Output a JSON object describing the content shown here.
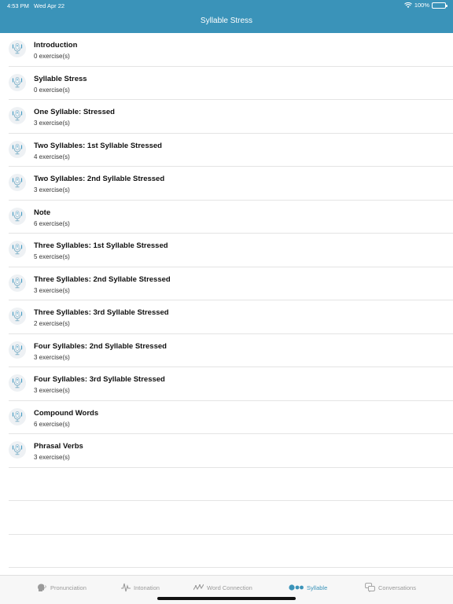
{
  "status": {
    "time": "4:53 PM",
    "date": "Wed Apr 22",
    "battery": "100%"
  },
  "header": {
    "title": "Syllable Stress"
  },
  "lessons": [
    {
      "title": "Introduction",
      "subtitle": "0 exercise(s)"
    },
    {
      "title": "Syllable Stress",
      "subtitle": "0 exercise(s)"
    },
    {
      "title": "One Syllable: Stressed",
      "subtitle": "3 exercise(s)"
    },
    {
      "title": "Two Syllables: 1st Syllable Stressed",
      "subtitle": "4 exercise(s)"
    },
    {
      "title": "Two Syllables: 2nd Syllable Stressed",
      "subtitle": "3 exercise(s)"
    },
    {
      "title": "Note",
      "subtitle": "6 exercise(s)"
    },
    {
      "title": "Three Syllables: 1st Syllable Stressed",
      "subtitle": "5 exercise(s)"
    },
    {
      "title": "Three Syllables: 2nd Syllable Stressed",
      "subtitle": "3 exercise(s)"
    },
    {
      "title": "Three Syllables: 3rd Syllable Stressed",
      "subtitle": "2 exercise(s)"
    },
    {
      "title": "Four Syllables: 2nd Syllable Stressed",
      "subtitle": "3 exercise(s)"
    },
    {
      "title": "Four Syllables: 3rd Syllable Stressed",
      "subtitle": "3 exercise(s)"
    },
    {
      "title": "Compound Words",
      "subtitle": "6 exercise(s)"
    },
    {
      "title": "Phrasal Verbs",
      "subtitle": "3 exercise(s)"
    }
  ],
  "row_icon": "microphone-icon",
  "tabs": [
    {
      "label": "Pronunciation",
      "icon": "head-speaking-icon",
      "active": false
    },
    {
      "label": "Intonation",
      "icon": "waveform-icon",
      "active": false
    },
    {
      "label": "Word Connection",
      "icon": "linked-waves-icon",
      "active": false
    },
    {
      "label": "Syllable",
      "icon": "dots-icon",
      "active": true
    },
    {
      "label": "Conversations",
      "icon": "chat-bubbles-icon",
      "active": false
    }
  ],
  "colors": {
    "accent": "#3a93b9",
    "inactive": "#9a9a9a"
  }
}
